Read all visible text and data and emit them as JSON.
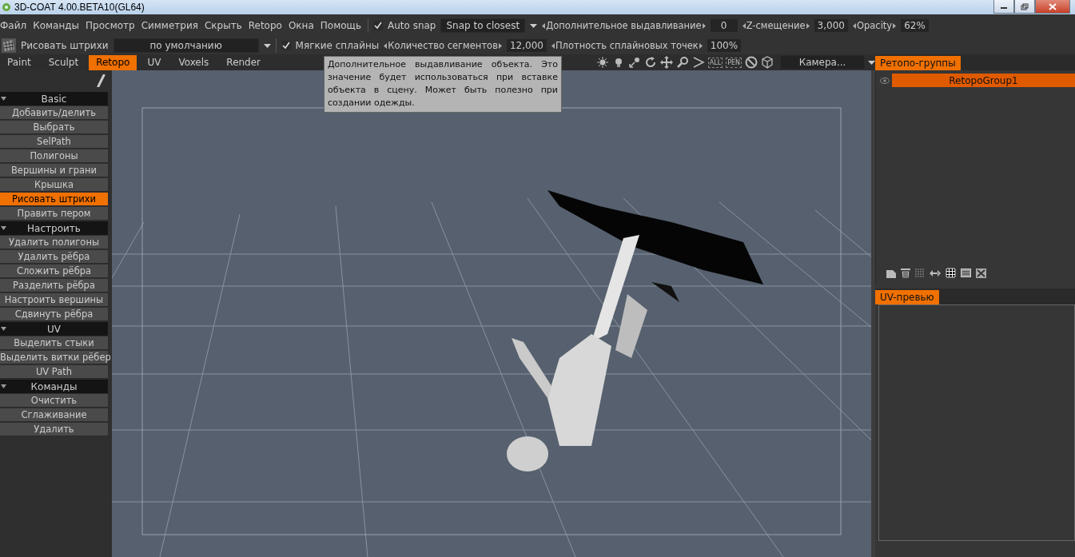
{
  "window": {
    "title": "3D-COAT 4.00.BETA10(GL64)"
  },
  "menu": [
    "Файл",
    "Команды",
    "Просмотр",
    "Симметрия",
    "Скрыть",
    "Retopo",
    "Окна",
    "Помощь"
  ],
  "snap": {
    "label": "Auto snap",
    "checked": true,
    "mode": "Snap to closest"
  },
  "params": [
    {
      "label": "Дополнительное выдавливание",
      "value": "0"
    },
    {
      "label": "Z-смещение",
      "value": "3,000"
    },
    {
      "label": "Opacity",
      "value": "62%"
    }
  ],
  "tool": {
    "name": "Рисовать штрихи",
    "preset": "по умолчанию",
    "soft_splines": {
      "label": "Мягкие сплайны",
      "checked": true
    }
  },
  "tool_params": [
    {
      "label": "Количество сегментов",
      "value": "12,000"
    },
    {
      "label": "Плотность сплайновых точек",
      "value": "100%"
    }
  ],
  "tabs": [
    {
      "label": "Paint",
      "selected": false
    },
    {
      "label": "Sculpt",
      "selected": false
    },
    {
      "label": "Retopo",
      "selected": true
    },
    {
      "label": "UV",
      "selected": false
    },
    {
      "label": "Voxels",
      "selected": false
    },
    {
      "label": "Render",
      "selected": false
    }
  ],
  "view_icon_labels": [
    "ALL",
    "PEN"
  ],
  "camera": "Камера...",
  "tooltip": "Дополнительное выдавливание объекта. Это значение будет использоваться при вставке объекта в сцену. Может быть полезно при создании одежды.",
  "sidebar": [
    {
      "title": "Basic",
      "expanded": true,
      "items": [
        {
          "label": "Добавить/делить",
          "selected": false
        },
        {
          "label": "Выбрать",
          "selected": false
        },
        {
          "label": "SelPath",
          "selected": false
        },
        {
          "label": "Полигоны",
          "selected": false
        },
        {
          "label": "Вершины и грани",
          "selected": false
        },
        {
          "label": "Крышка",
          "selected": false
        },
        {
          "label": "Рисовать штрихи",
          "selected": true
        },
        {
          "label": "Править пером",
          "selected": false
        }
      ]
    },
    {
      "title": "Настроить",
      "expanded": true,
      "items": [
        {
          "label": "Удалить полигоны",
          "selected": false
        },
        {
          "label": "Удалить рёбра",
          "selected": false
        },
        {
          "label": "Сложить рёбра",
          "selected": false
        },
        {
          "label": "Разделить рёбра",
          "selected": false
        },
        {
          "label": "Настроить вершины",
          "selected": false
        },
        {
          "label": "Сдвинуть рёбра",
          "selected": false
        }
      ]
    },
    {
      "title": "UV",
      "expanded": true,
      "items": [
        {
          "label": "Выделить стыки",
          "selected": false
        },
        {
          "label": "Выделить витки рёбер",
          "selected": false
        },
        {
          "label": "UV Path",
          "selected": false
        }
      ]
    },
    {
      "title": "Команды",
      "expanded": true,
      "items": [
        {
          "label": "Очистить",
          "selected": false
        },
        {
          "label": "Сглаживание",
          "selected": false
        },
        {
          "label": "Удалить",
          "selected": false
        }
      ]
    }
  ],
  "retopo_groups": {
    "tab": "Ретопо-группы",
    "groups": [
      {
        "name": "RetopoGroup1",
        "visible": true,
        "selected": true
      }
    ]
  },
  "uv_preview": {
    "tab": "UV-превью"
  }
}
